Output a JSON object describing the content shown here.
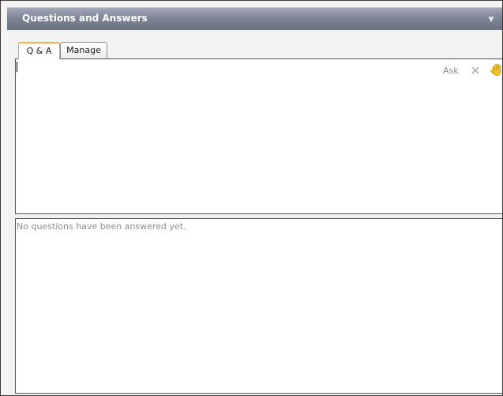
{
  "panel": {
    "title": "Questions and Answers",
    "menu_icon": "chevron-down-icon",
    "close_icon": "close-icon"
  },
  "tabs": [
    {
      "label": "Q & A",
      "selected": true
    },
    {
      "label": "Manage",
      "selected": false
    }
  ],
  "question_area": {
    "input_value": "",
    "ask_label": "Ask",
    "clear_icon": "clear-x-icon",
    "raise_hand_icon": "raise-hand-icon"
  },
  "answers_area": {
    "empty_message": "No questions have been answered yet."
  },
  "colors": {
    "title_bar": "#7f8697",
    "selected_tab_accent": "#f0b24a",
    "muted_text": "#8d8d8d"
  }
}
